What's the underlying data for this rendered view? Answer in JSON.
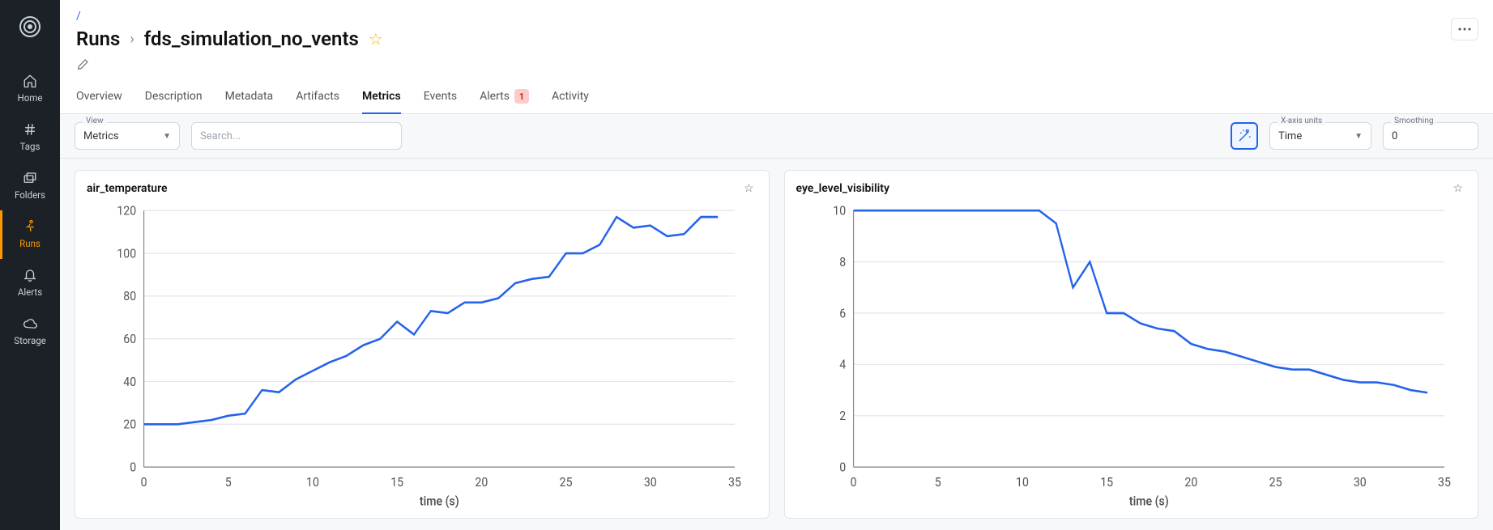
{
  "sidebar": {
    "items": [
      {
        "key": "home",
        "label": "Home"
      },
      {
        "key": "tags",
        "label": "Tags"
      },
      {
        "key": "folders",
        "label": "Folders"
      },
      {
        "key": "runs",
        "label": "Runs"
      },
      {
        "key": "alerts",
        "label": "Alerts"
      },
      {
        "key": "storage",
        "label": "Storage"
      }
    ]
  },
  "header": {
    "breadcrumb_root": "/",
    "section": "Runs",
    "run_name": "fds_simulation_no_vents"
  },
  "tabs": {
    "items": [
      {
        "label": "Overview"
      },
      {
        "label": "Description"
      },
      {
        "label": "Metadata"
      },
      {
        "label": "Artifacts"
      },
      {
        "label": "Metrics"
      },
      {
        "label": "Events"
      },
      {
        "label": "Alerts",
        "badge": "1"
      },
      {
        "label": "Activity"
      }
    ],
    "active": "Metrics"
  },
  "toolbar": {
    "view_label": "View",
    "view_value": "Metrics",
    "search_placeholder": "Search...",
    "xaxis_label": "X-axis units",
    "xaxis_value": "Time",
    "smoothing_label": "Smoothing",
    "smoothing_value": "0"
  },
  "chart_data": [
    {
      "type": "line",
      "title": "air_temperature",
      "xlabel": "time (s)",
      "ylabel": "",
      "xlim": [
        0,
        35
      ],
      "ylim": [
        0,
        120
      ],
      "xticks": [
        0,
        5,
        10,
        15,
        20,
        25,
        30,
        35
      ],
      "yticks": [
        0,
        20,
        40,
        60,
        80,
        100,
        120
      ],
      "series": [
        {
          "name": "air_temperature",
          "color": "#2563eb",
          "x": [
            0,
            1,
            2,
            3,
            4,
            5,
            6,
            7,
            8,
            9,
            10,
            11,
            12,
            13,
            14,
            15,
            16,
            17,
            18,
            19,
            20,
            21,
            22,
            23,
            24,
            25,
            26,
            27,
            28,
            29,
            30,
            31,
            32,
            33,
            34
          ],
          "y": [
            20,
            20,
            20,
            21,
            22,
            24,
            25,
            36,
            35,
            41,
            45,
            49,
            52,
            57,
            60,
            68,
            62,
            73,
            72,
            77,
            77,
            79,
            86,
            88,
            89,
            100,
            100,
            104,
            117,
            112,
            113,
            108,
            109,
            117,
            117
          ]
        }
      ]
    },
    {
      "type": "line",
      "title": "eye_level_visibility",
      "xlabel": "time (s)",
      "ylabel": "",
      "xlim": [
        0,
        35
      ],
      "ylim": [
        0,
        10
      ],
      "xticks": [
        0,
        5,
        10,
        15,
        20,
        25,
        30,
        35
      ],
      "yticks": [
        0,
        2,
        4,
        6,
        8,
        10
      ],
      "series": [
        {
          "name": "eye_level_visibility",
          "color": "#2563eb",
          "x": [
            0,
            1,
            2,
            3,
            4,
            5,
            6,
            7,
            8,
            9,
            10,
            11,
            12,
            13,
            14,
            15,
            16,
            17,
            18,
            19,
            20,
            21,
            22,
            23,
            24,
            25,
            26,
            27,
            28,
            29,
            30,
            31,
            32,
            33,
            34
          ],
          "y": [
            10,
            10,
            10,
            10,
            10,
            10,
            10,
            10,
            10,
            10,
            10,
            10,
            9.5,
            7.0,
            8.0,
            6.0,
            6.0,
            5.6,
            5.4,
            5.3,
            4.8,
            4.6,
            4.5,
            4.3,
            4.1,
            3.9,
            3.8,
            3.8,
            3.6,
            3.4,
            3.3,
            3.3,
            3.2,
            3.0,
            2.9
          ]
        }
      ]
    }
  ]
}
